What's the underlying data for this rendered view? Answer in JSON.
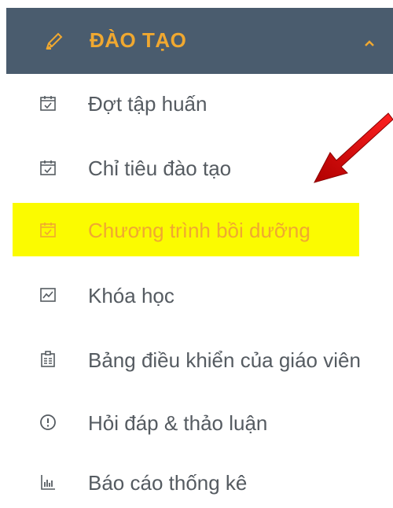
{
  "header": {
    "title": "ĐÀO TẠO",
    "icon": "pencil-icon",
    "chevron": "chevron-up-icon",
    "bg": "#4a5c6e",
    "accent": "#f0a830"
  },
  "menu": {
    "items": [
      {
        "label": "Đợt tập huấn",
        "icon": "calendar-check-icon"
      },
      {
        "label": "Chỉ tiêu đào tạo",
        "icon": "calendar-check-icon"
      },
      {
        "label": "Chương trình bồi dưỡng",
        "icon": "calendar-check-icon",
        "active": true
      },
      {
        "label": "Khóa học",
        "icon": "chart-line-icon"
      },
      {
        "label": "Bảng điều khiển của giáo viên",
        "icon": "id-card-icon"
      },
      {
        "label": "Hỏi đáp & thảo luận",
        "icon": "alert-circle-icon"
      },
      {
        "label": "Báo cáo thống kê",
        "icon": "bar-chart-icon"
      }
    ]
  },
  "highlight_color": "#fbfb00",
  "annotation": {
    "arrow_color": "#e01010"
  }
}
